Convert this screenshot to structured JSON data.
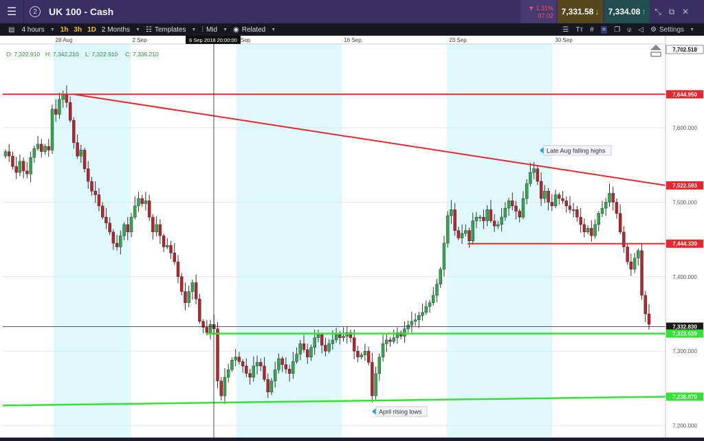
{
  "header": {
    "menu_icon": "hamburger-icon",
    "workspace_count": "2",
    "instrument": "UK 100 - Cash",
    "change_pct": "▼ 1.31%",
    "change_abs": "97.02",
    "sell_price": "7,331.58",
    "buy_price": "7,334.08",
    "window_icons": [
      "expand-icon",
      "popout-icon",
      "close-icon"
    ]
  },
  "toolbar": {
    "timeframe": "4 hours",
    "quick_intervals": [
      "1h",
      "3h",
      "1D"
    ],
    "range": "2 Months",
    "templates": "Templates",
    "price_type": "Mid",
    "related": "Related",
    "settings": "Settings"
  },
  "ohlc": {
    "o": "O: 7,322.910",
    "h": "H: 7,342.210",
    "l": "L: 7,322.910",
    "c": "C: 7,336.210"
  },
  "crosshair_time": "6 Sep 2018 20:00:00",
  "x_ticks": [
    "28 Aug",
    "2 Sep",
    "Sep",
    "16 Sep",
    "23 Sep",
    "30 Sep"
  ],
  "annotations": {
    "falling": "Late Aug falling highs",
    "rising": "April rising lows"
  },
  "price_labels": {
    "top": "7,702.518",
    "red1": "7,644.950",
    "red2": "7,522.593",
    "red3": "7,444.330",
    "current": "7,332.830",
    "green1": "7,323.639",
    "green2": "7,238.870"
  },
  "colors": {
    "red_line": "#e8262c",
    "green_line": "#33e233",
    "up_candle": "#2fa84f",
    "down_candle": "#b8232d",
    "weekend_shade": "#dff8fb"
  },
  "chart_data": {
    "type": "candlestick",
    "x_range": [
      "28 Aug",
      "30 Sep"
    ],
    "y_ticks": [
      7600,
      7500,
      7400,
      7300,
      7200
    ],
    "y_tick_labels": [
      "7,600.000",
      "7,500.000",
      "7,400.000",
      "7,300.000",
      "7,200.000"
    ],
    "ylim": [
      7180,
      7705
    ],
    "horizontal_levels": [
      7644.95,
      7444.33,
      7323.639
    ],
    "falling_trendline": {
      "from": 7644.95,
      "to": 7522.593
    },
    "rising_trendline": {
      "from": 7227,
      "to": 7238.87
    },
    "current_price": 7332.83,
    "closes": [
      7568,
      7562,
      7548,
      7540,
      7555,
      7542,
      7538,
      7560,
      7572,
      7578,
      7568,
      7575,
      7570,
      7625,
      7618,
      7638,
      7645,
      7634,
      7610,
      7580,
      7562,
      7570,
      7545,
      7528,
      7515,
      7510,
      7495,
      7480,
      7472,
      7460,
      7445,
      7440,
      7455,
      7470,
      7460,
      7480,
      7495,
      7505,
      7498,
      7502,
      7480,
      7460,
      7470,
      7455,
      7440,
      7442,
      7432,
      7420,
      7400,
      7380,
      7365,
      7380,
      7392,
      7370,
      7340,
      7332,
      7325,
      7336,
      7330,
      7260,
      7240,
      7265,
      7275,
      7288,
      7292,
      7286,
      7280,
      7270,
      7265,
      7280,
      7285,
      7280,
      7262,
      7245,
      7260,
      7275,
      7290,
      7282,
      7276,
      7270,
      7286,
      7296,
      7310,
      7302,
      7292,
      7305,
      7318,
      7322,
      7308,
      7300,
      7310,
      7315,
      7322,
      7318,
      7320,
      7325,
      7318,
      7300,
      7292,
      7295,
      7300,
      7285,
      7240,
      7270,
      7292,
      7310,
      7315,
      7313,
      7318,
      7325,
      7320,
      7330,
      7335,
      7340,
      7342,
      7348,
      7352,
      7360,
      7365,
      7375,
      7390,
      7410,
      7445,
      7482,
      7490,
      7462,
      7452,
      7458,
      7462,
      7448,
      7475,
      7480,
      7480,
      7475,
      7490,
      7475,
      7468,
      7470,
      7480,
      7492,
      7502,
      7495,
      7488,
      7480,
      7505,
      7525,
      7540,
      7545,
      7528,
      7505,
      7515,
      7500,
      7495,
      7510,
      7505,
      7502,
      7495,
      7490,
      7490,
      7480,
      7470,
      7460,
      7465,
      7455,
      7470,
      7485,
      7492,
      7500,
      7512,
      7500,
      7485,
      7460,
      7440,
      7420,
      7410,
      7425,
      7435,
      7375,
      7350,
      7336
    ]
  }
}
